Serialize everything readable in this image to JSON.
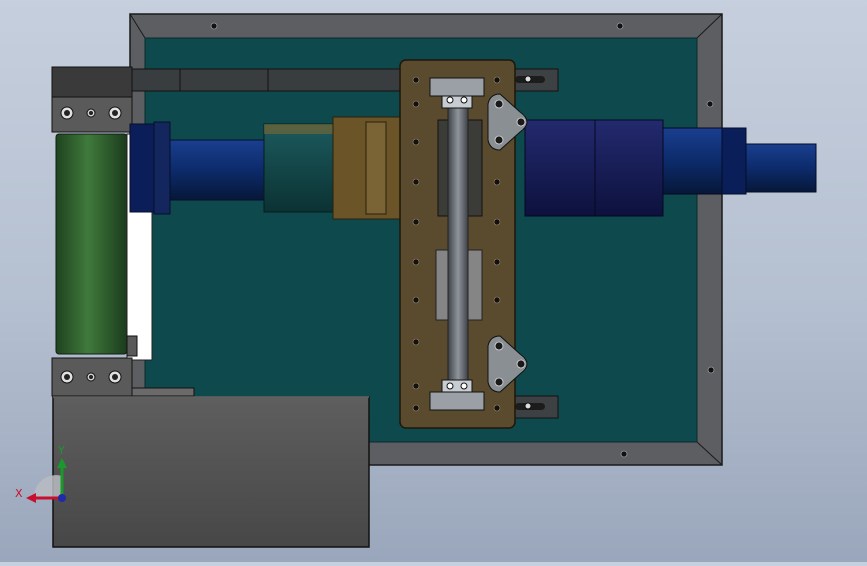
{
  "view": {
    "background_top": "#c6cfdd",
    "background_bottom": "#9aa6bb"
  },
  "model": {
    "components": [
      "base-plate",
      "frame-border",
      "guide-rail-strip",
      "drive-roller",
      "roller-bracket-top",
      "roller-bracket-bottom",
      "gearbox-block",
      "drive-shaft",
      "coupling",
      "motor-housing",
      "motor-shaft",
      "carriage-plate",
      "linear-rod",
      "rod-mount-block",
      "lifting-lug-top",
      "lifting-lug-bottom",
      "slide-guide-top",
      "slide-guide-bottom"
    ],
    "colors": {
      "plate": "#0e4a4d",
      "frame": "#5d5e62",
      "roller": "#2b5a2a",
      "carriage": "#5a4a2e",
      "motor": "#141a4e",
      "shaft": "#0c2a66",
      "coupling": "#6a5a2a",
      "rod": "#6a7076",
      "gearbox": "#545454"
    }
  },
  "triad": {
    "x_label": "X",
    "y_label": "Y",
    "x_color": "#c8102e",
    "y_color": "#1a9a2a",
    "z_color": "#1e2aa8"
  }
}
